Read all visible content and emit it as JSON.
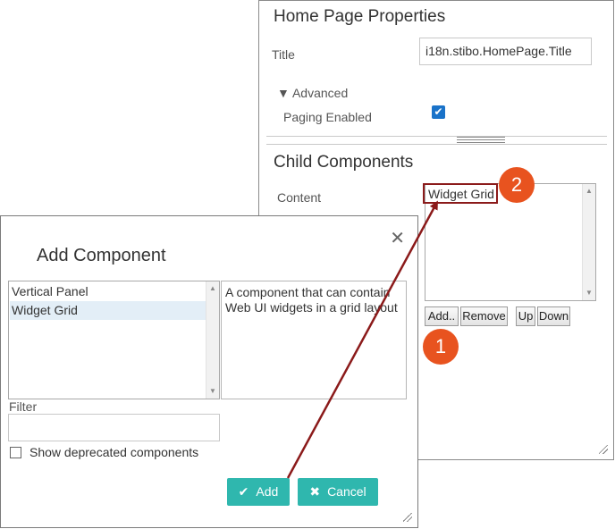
{
  "props": {
    "header": "Home Page Properties",
    "title_label": "Title",
    "title_value": "i18n.stibo.HomePage.Title",
    "advanced_label": "▼ Advanced",
    "paging_label": "Paging Enabled",
    "paging_checked": "✔",
    "child_header": "Child Components",
    "content_label": "Content",
    "content_items": [
      "Widget Grid"
    ],
    "buttons": {
      "add": "Add..",
      "remove": "Remove",
      "up": "Up",
      "down": "Down"
    }
  },
  "dialog": {
    "title": "Add Component",
    "close": "✕",
    "components": [
      "Vertical Panel",
      "Widget Grid"
    ],
    "description": "A component that can contain Web UI widgets in a grid layout",
    "filter_label": "Filter",
    "filter_value": "",
    "deprecated_label": "Show deprecated components",
    "add_label": "Add",
    "cancel_label": "Cancel"
  },
  "callouts": {
    "one": "1",
    "two": "2"
  },
  "colors": {
    "accent": "#2fb7ae",
    "callout": "#e8531f",
    "arrow": "#8b1a1a",
    "check": "#1a73c9"
  }
}
